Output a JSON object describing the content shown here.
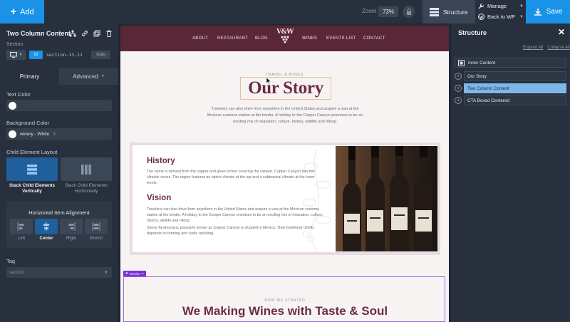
{
  "topbar": {
    "add_label": "Add",
    "zoom_label": "Zoom",
    "zoom_value": "73%",
    "structure_label": "Structure",
    "manage_label": "Manage",
    "back_label": "Back to WP",
    "save_label": "Save",
    "accent": "#1a92e8"
  },
  "left_panel": {
    "title": "Two Column Content",
    "section_label": "Section",
    "id_chip": "id",
    "id_value": "section-13-11",
    "state_chip": "state",
    "tabs": {
      "primary": "Primary",
      "advanced": "Advanced"
    },
    "text_color_label": "Text Color",
    "bg_color_label": "Background Color",
    "bg_color_value": "winery - White",
    "bg_clear": "X",
    "child_layout_label": "Child Element Layout",
    "layout_vertical": "Stack Child Elements Vertically",
    "layout_horizontal": "Stack Child Elements Horizontally",
    "h_align_label": "Horizontal Item Alignment",
    "align_left": "Left",
    "align_center": "Center",
    "align_right": "Right",
    "align_stretch": "Stretch",
    "tag_label": "Tag",
    "tag_value": "section"
  },
  "site": {
    "nav": {
      "about": "ABOUT",
      "restaurant": "RESTAURANT",
      "blog": "BLOG",
      "logo": "V&W",
      "wines": "WINES",
      "events": "EVENTS LIST",
      "contact": "CONTACT"
    },
    "eyebrow": "TRAVEL & WINES",
    "heading": "Our Story",
    "intro": "Travelers can also drive from anywhere in the United States and acquire a visa at the Mexican customs station at the border. A holiday to the Copper Canyon promises to be an exciting mix of relaxation, culture, history, wildlife and hiking.",
    "history_title": "History",
    "history_text": "The name is derived from the copper and green lichen covering the canyon. Copper Canyon has two climatic zones. The region features an alpine climate at the top and a subtropical climate at the lower levels.",
    "vision_title": "Vision",
    "vision_text1": "Travelers can also drive from anywhere in the United States and acquire a visa at the Mexican customs station at the border. A holiday to the Copper Canyon promises to be an exciting mix of relaxation, culture, history, wildlife and hiking.",
    "vision_text2": "Sierra Tarahumara, popularly known as Copper Canyon is situated in Mexico. Their livelihood chiefly depends on farming and cattle ranching.",
    "section_badge": "Section",
    "section_eyebrow": "HOW WE STARTED",
    "section_heading": "We Making Wines with Taste & Soul",
    "brand_color": "#6b2c42"
  },
  "structure": {
    "title": "Structure",
    "expand_all": "Expand All",
    "collapse_all": "Collapse All",
    "items": [
      "Inner Content",
      "Our Story",
      "Two Column Content",
      "CTA Boxed Centered"
    ]
  }
}
